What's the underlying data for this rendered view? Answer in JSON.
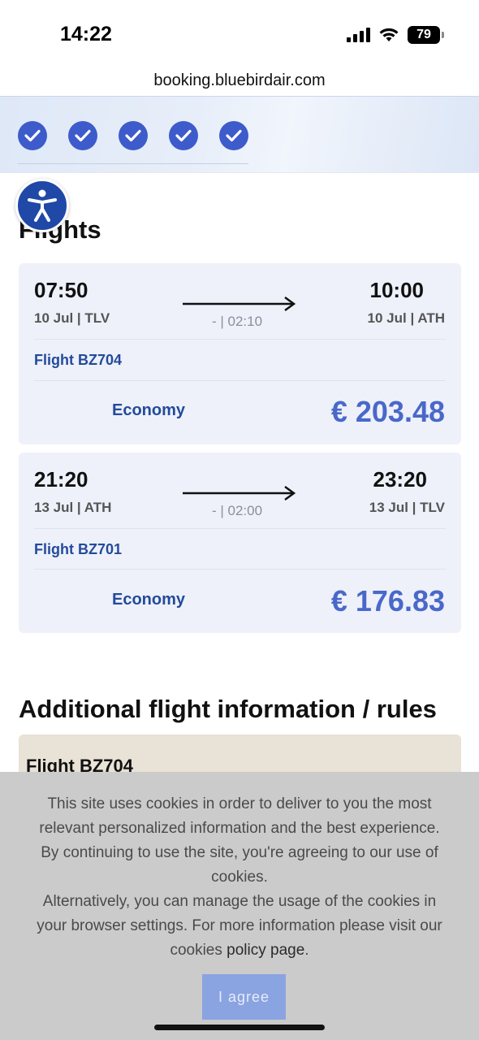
{
  "status_bar": {
    "time": "14:22",
    "battery": "79"
  },
  "browser": {
    "url": "booking.bluebirdair.com"
  },
  "progress": {
    "completed_steps": 5,
    "step_icon": "checkmark-icon"
  },
  "accessibility": {
    "icon": "accessibility-icon"
  },
  "flights_section": {
    "title": "Flights"
  },
  "flights": [
    {
      "depart_time": "07:50",
      "depart_info": "10 Jul | TLV",
      "arrive_time": "10:00",
      "arrive_info": "10 Jul | ATH",
      "duration": "- | 02:10",
      "flight_number": "Flight BZ704",
      "cabin": "Economy",
      "price": "€ 203.48"
    },
    {
      "depart_time": "21:20",
      "depart_info": "13 Jul | ATH",
      "arrive_time": "23:20",
      "arrive_info": "13 Jul | TLV",
      "duration": "- | 02:00",
      "flight_number": "Flight BZ701",
      "cabin": "Economy",
      "price": "€ 176.83"
    }
  ],
  "rules_section": {
    "title": "Additional flight information / rules",
    "first_card_title": "Flight BZ704"
  },
  "cookie_banner": {
    "text_line_1": "This site uses cookies in order to deliver to you the most relevant personalized information and the best experience. By continuing to use the site, you're agreeing to our use of cookies.",
    "text_line_2": "Alternatively, you can manage the usage of the cookies in your browser settings. For more information please visit our cookies ",
    "policy_link": "policy page",
    "text_end": ".",
    "agree_label": "I agree"
  },
  "colors": {
    "accent": "#3e5bcb",
    "price": "#4a68c9",
    "link": "#234b9a",
    "card_bg": "#eef1fa"
  }
}
